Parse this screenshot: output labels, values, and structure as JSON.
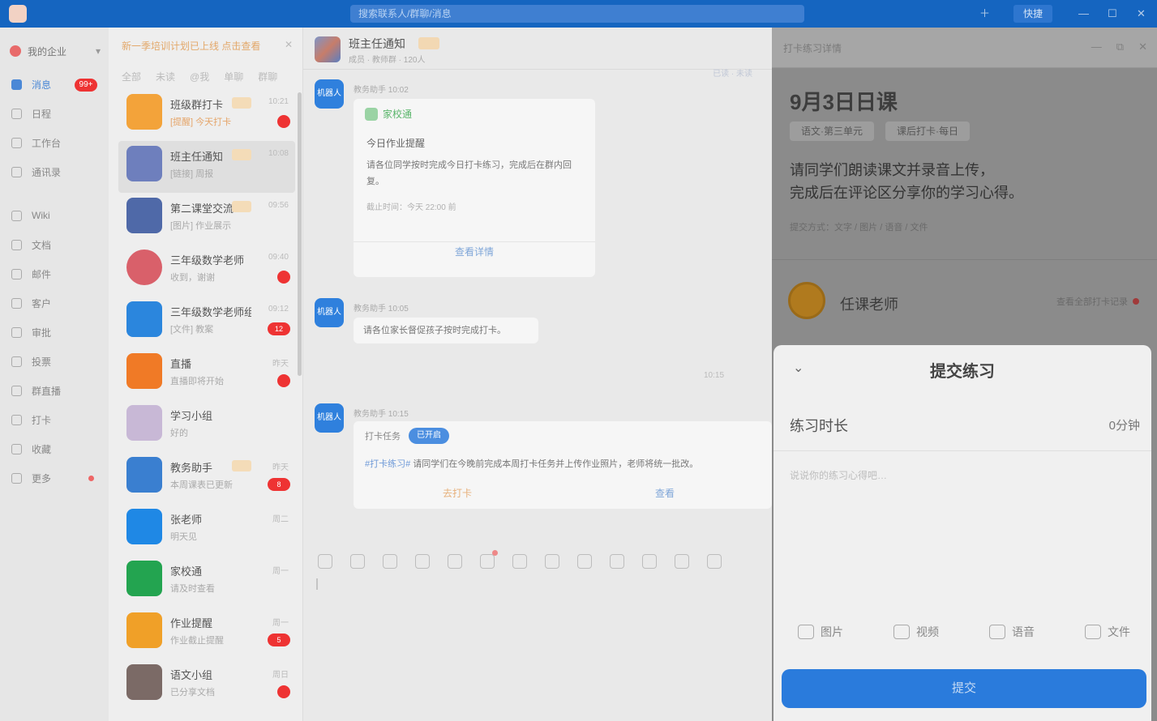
{
  "titlebar": {
    "search_placeholder": "搜索联系人/群聊/消息",
    "btn_label": "快捷"
  },
  "leftnav": {
    "org_name": "我的企业",
    "items": [
      {
        "label": "消息",
        "active": true,
        "badge": "99+"
      },
      {
        "label": "日程"
      },
      {
        "label": "工作台"
      },
      {
        "label": "通讯录"
      },
      {
        "label": "Wiki"
      },
      {
        "label": "文档"
      },
      {
        "label": "邮件"
      },
      {
        "label": "客户"
      },
      {
        "label": "审批"
      },
      {
        "label": "投票"
      },
      {
        "label": "群直播"
      },
      {
        "label": "打卡"
      },
      {
        "label": "收藏"
      },
      {
        "label": "更多",
        "dot": true
      }
    ]
  },
  "convlist": {
    "notice": "新一季培训计划已上线 点击查看",
    "filters": [
      "全部",
      "未读",
      "@我",
      "单聊",
      "群聊"
    ],
    "items": [
      {
        "name": "班级群打卡",
        "preview": "[提醒] 今天打卡",
        "preview_warn": true,
        "time": "10:21",
        "badge": "dot",
        "av": "#f3a33a",
        "tag": true
      },
      {
        "name": "班主任通知",
        "preview": "[链接] 周报",
        "time": "10:08",
        "selected": true,
        "av": "#6e7fbd",
        "tag": true
      },
      {
        "name": "第二课堂交流",
        "preview": "[图片] 作业展示",
        "time": "09:56",
        "av": "#4f69a8",
        "tag": true
      },
      {
        "name": "三年级数学老师",
        "preview": "收到，谢谢",
        "time": "09:40",
        "badge": "dot",
        "av": "#d9606a",
        "round": true
      },
      {
        "name": "三年级数学老师组",
        "preview": "[文件] 教案",
        "time": "09:12",
        "badge": "pill",
        "badge_text": "12",
        "av": "#2b86dd"
      },
      {
        "name": "直播",
        "preview": "直播即将开始",
        "time": "昨天",
        "badge": "dot",
        "av": "#f07a26"
      },
      {
        "name": "学习小组",
        "preview": "好的",
        "time": "",
        "av": "#c8b8d6"
      },
      {
        "name": "教务助手",
        "preview": "本周课表已更新",
        "time": "昨天",
        "badge": "pill",
        "badge_text": "8",
        "av": "#3a7fd0",
        "tag": true
      },
      {
        "name": "张老师",
        "preview": "明天见",
        "time": "周二",
        "av": "#1f88e5"
      },
      {
        "name": "家校通",
        "preview": "请及时查看",
        "time": "周一",
        "av": "#23a450"
      },
      {
        "name": "作业提醒",
        "preview": "作业截止提醒",
        "time": "周一",
        "badge": "pill",
        "badge_text": "5",
        "av": "#f0a028"
      },
      {
        "name": "语文小组",
        "preview": "已分享文档",
        "time": "周日",
        "badge": "dot",
        "av": "#7b6a66"
      }
    ]
  },
  "chat": {
    "title": "班主任通知",
    "sub": "成员 · 教师群 · 120人",
    "meta": "已读 · 未读",
    "msg1": {
      "avatar": "机器人",
      "sender": "教务助手 10:02",
      "brand": "家校通",
      "title": "今日作业提醒",
      "desc": "请各位同学按时完成今日打卡练习，完成后在群内回复。",
      "foot": "截止时间：今天 22:00 前",
      "button": "查看详情"
    },
    "msg2": {
      "avatar": "机器人",
      "sender": "教务助手 10:05",
      "text": "请各位家长督促孩子按时完成打卡。"
    },
    "time2": "10:15",
    "msg3": {
      "avatar": "机器人",
      "sender": "教务助手 10:15",
      "prefix": "打卡任务",
      "chip": "已开启",
      "link": "#打卡练习#",
      "text": "请同学们在今晚前完成本周打卡任务并上传作业照片，老师将统一批改。",
      "btn_a": "去打卡",
      "btn_b": "查看"
    }
  },
  "rpanel": {
    "head_title": "打卡练习详情",
    "title": "9月3日日课",
    "tags": [
      "语文·第三单元",
      "课后打卡·每日"
    ],
    "intro": "请同学们朗读课文并录音上传，\n完成后在评论区分享你的学习心得。",
    "small": "提交方式：文字 / 图片 / 语音 / 文件",
    "user_name": "任课老师",
    "user_link": "查看全部打卡记录"
  },
  "sheet": {
    "title": "提交练习",
    "row_label": "练习时长",
    "row_value": "0分钟",
    "placeholder": "说说你的练习心得吧…",
    "actions": [
      "图片",
      "视频",
      "语音",
      "文件"
    ],
    "submit": "提交"
  }
}
